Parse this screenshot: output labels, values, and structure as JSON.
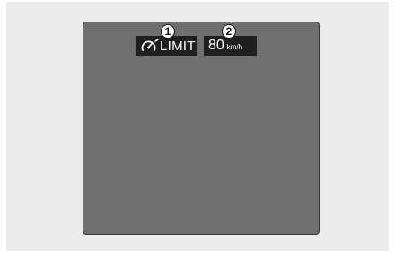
{
  "indicator": {
    "limit_label": "LIMIT",
    "speed_value": "80",
    "speed_unit": "km/h",
    "icon": "speed-limiter-gauge-icon"
  },
  "callouts": [
    "1",
    "2"
  ],
  "colors": {
    "screen": "#6f6f6f",
    "chip_background": "#1f1f1f",
    "chip_text": "#ffffff"
  }
}
